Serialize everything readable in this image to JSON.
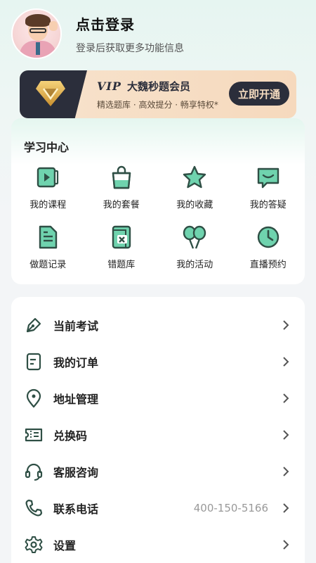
{
  "profile": {
    "title": "点击登录",
    "subtitle": "登录后获取更多功能信息"
  },
  "vip": {
    "logo": "VIP",
    "name": "大魏秒题会员",
    "desc": "精选题库 · 高效提分 · 畅享特权*",
    "button": "立即开通"
  },
  "study_center": {
    "title": "学习中心",
    "items": [
      {
        "label": "我的课程",
        "icon": "video-course-icon"
      },
      {
        "label": "我的套餐",
        "icon": "shopping-bag-icon"
      },
      {
        "label": "我的收藏",
        "icon": "star-icon"
      },
      {
        "label": "我的答疑",
        "icon": "chat-message-icon"
      },
      {
        "label": "做题记录",
        "icon": "document-record-icon"
      },
      {
        "label": "错题库",
        "icon": "error-book-icon"
      },
      {
        "label": "我的活动",
        "icon": "balloons-icon"
      },
      {
        "label": "直播预约",
        "icon": "clock-icon"
      }
    ]
  },
  "menu": {
    "items": [
      {
        "label": "当前考试",
        "icon": "pen-icon"
      },
      {
        "label": "我的订单",
        "icon": "order-icon"
      },
      {
        "label": "地址管理",
        "icon": "location-pin-icon"
      },
      {
        "label": "兑换码",
        "icon": "ticket-icon"
      },
      {
        "label": "客服咨询",
        "icon": "headset-icon"
      },
      {
        "label": "联系电话",
        "icon": "phone-icon",
        "value": "400-150-5166"
      },
      {
        "label": "设置",
        "icon": "gear-icon"
      }
    ]
  },
  "colors": {
    "accent": "#2f8a72",
    "accent_fill": "#6fd3ae",
    "vip_dark": "#2b2e3b",
    "vip_gold": "#f6dcc0"
  }
}
